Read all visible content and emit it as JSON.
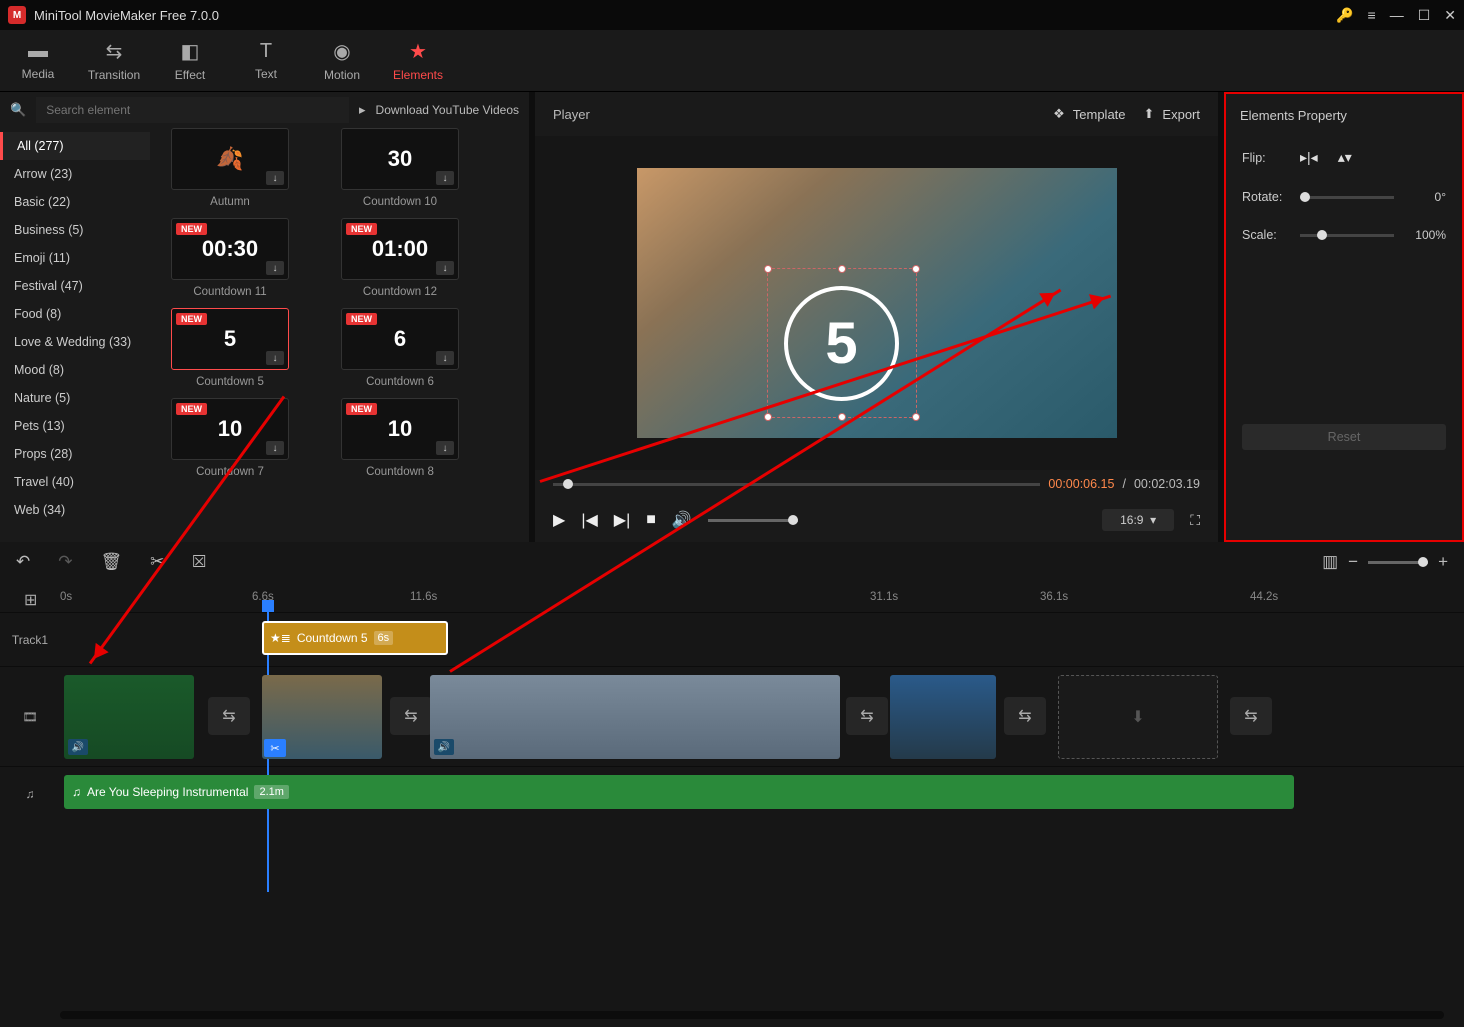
{
  "app": {
    "title": "MiniTool MovieMaker Free 7.0.0"
  },
  "tabs": {
    "media": "Media",
    "transition": "Transition",
    "effect": "Effect",
    "text": "Text",
    "motion": "Motion",
    "elements": "Elements"
  },
  "library": {
    "search_placeholder": "Search element",
    "download_yt": "Download YouTube Videos",
    "categories": [
      {
        "label": "All (277)",
        "active": true
      },
      {
        "label": "Arrow (23)"
      },
      {
        "label": "Basic (22)"
      },
      {
        "label": "Business (5)"
      },
      {
        "label": "Emoji (11)"
      },
      {
        "label": "Festival (47)"
      },
      {
        "label": "Food (8)"
      },
      {
        "label": "Love & Wedding (33)"
      },
      {
        "label": "Mood (8)"
      },
      {
        "label": "Nature (5)"
      },
      {
        "label": "Pets (13)"
      },
      {
        "label": "Props (28)"
      },
      {
        "label": "Travel (40)"
      },
      {
        "label": "Web (34)"
      }
    ],
    "items": [
      {
        "label": "Autumn",
        "preview": "🍂",
        "new": false
      },
      {
        "label": "Countdown 10",
        "preview": "30",
        "new": false
      },
      {
        "label": "Countdown 11",
        "preview": "00:30",
        "new": true
      },
      {
        "label": "Countdown 12",
        "preview": "01:00",
        "new": true
      },
      {
        "label": "Countdown 5",
        "preview": "5",
        "new": true,
        "selected": true
      },
      {
        "label": "Countdown 6",
        "preview": "6",
        "new": true
      },
      {
        "label": "Countdown 7",
        "preview": "10",
        "new": true
      },
      {
        "label": "Countdown 8",
        "preview": "10",
        "new": true
      }
    ]
  },
  "player": {
    "title": "Player",
    "template": "Template",
    "export": "Export",
    "overlay_num": "5",
    "tc_current": "00:00:06.15",
    "tc_sep": "/",
    "tc_total": "00:02:03.19",
    "aspect": "16:9"
  },
  "props": {
    "title": "Elements Property",
    "flip_label": "Flip:",
    "rotate_label": "Rotate:",
    "rotate_val": "0°",
    "scale_label": "Scale:",
    "scale_val": "100%",
    "reset": "Reset"
  },
  "timeline": {
    "ticks": [
      "0s",
      "6.6s",
      "11.6s",
      "31.1s",
      "36.1s",
      "44.2s"
    ],
    "track1_label": "Track1",
    "element_clip": {
      "name": "Countdown 5",
      "duration": "6s"
    },
    "audio_clip": {
      "name": "Are You Sleeping Instrumental",
      "duration": "2.1m"
    }
  }
}
